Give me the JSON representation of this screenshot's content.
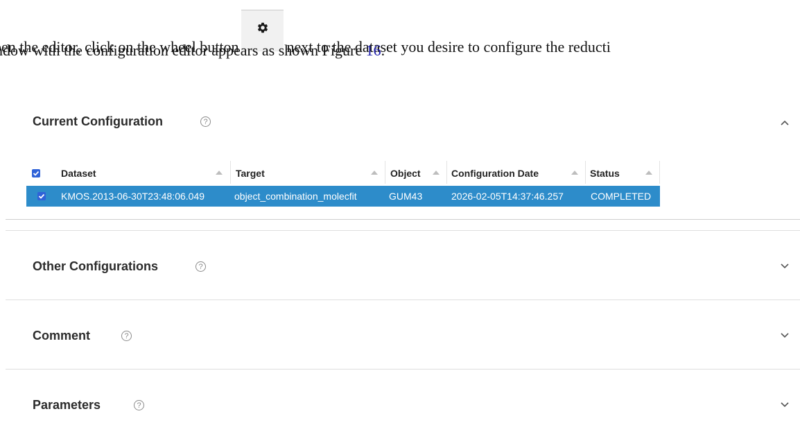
{
  "doc": {
    "line1_before": "pen the editor, click on the wheel button",
    "line1_after": "next to the dataset you desire to configure the reducti",
    "line2_before": "ndow with the configuration editor appears as shown Figure ",
    "figure_ref": "16",
    "line2_after": "."
  },
  "icons": {
    "gear": "gear-icon",
    "help": "help-circle-icon",
    "collapse": "chevron-up-icon",
    "expand": "chevron-down-icon",
    "check": "checkbox-checked-icon"
  },
  "panels": {
    "current": {
      "title": "Current Configuration",
      "help": "?"
    },
    "other": {
      "title": "Other Configurations",
      "help": "?"
    },
    "comment": {
      "title": "Comment",
      "help": "?"
    },
    "parameters": {
      "title": "Parameters",
      "help": "?"
    }
  },
  "table": {
    "columns": [
      "Dataset",
      "Target",
      "Object",
      "Configuration Date",
      "Status"
    ],
    "rows": [
      {
        "dataset": "KMOS.2013-06-30T23:48:06.049",
        "target": "object_combination_molecfit",
        "object": "GUM43",
        "configuration_date": "2026-02-05T14:37:46.257",
        "status": "COMPLETED",
        "selected": true
      }
    ]
  },
  "colors": {
    "selected_row": "#2d8cca",
    "checkbox": "#2f62d8",
    "figure_link": "#1a1aa8"
  }
}
